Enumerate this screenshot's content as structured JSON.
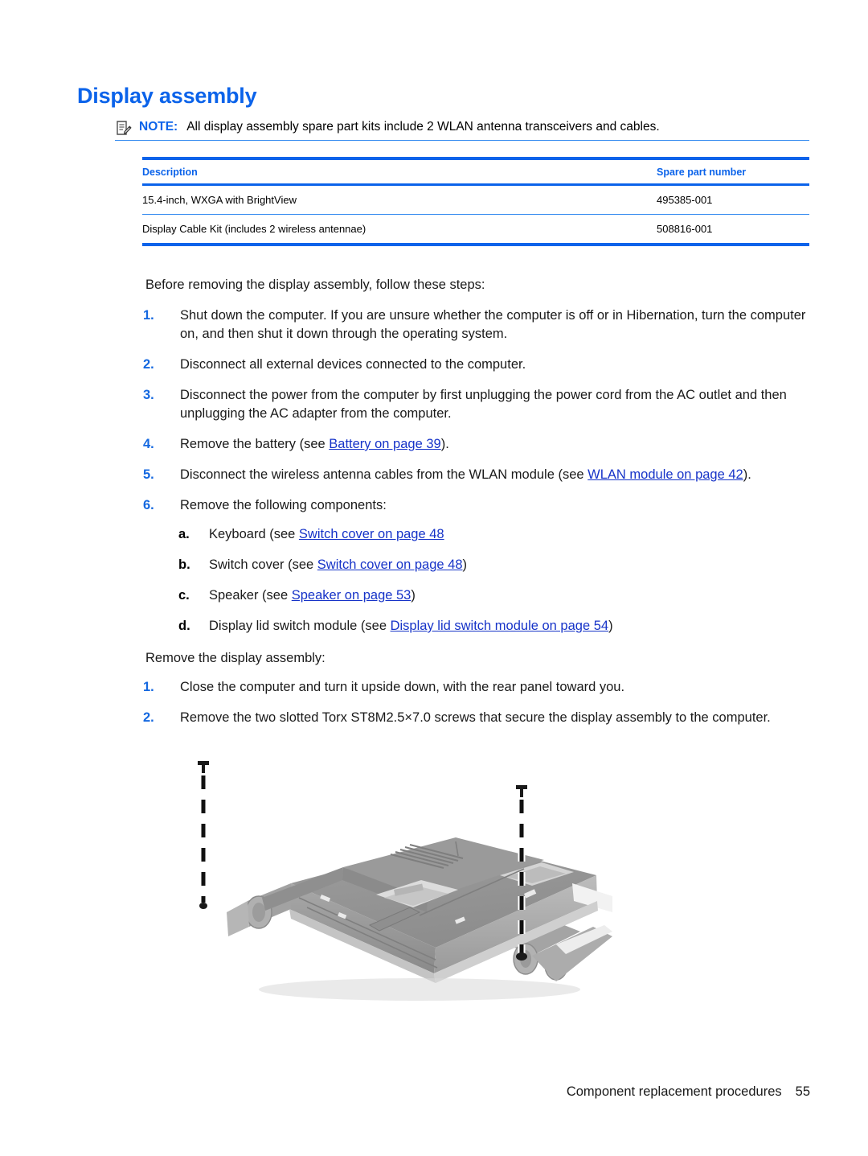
{
  "heading": "Display assembly",
  "note": {
    "icon": "note-pad-pencil-icon",
    "label": "NOTE:",
    "text": "All display assembly spare part kits include 2 WLAN antenna transceivers and cables."
  },
  "table": {
    "columns": [
      "Description",
      "Spare part number"
    ],
    "rows": [
      {
        "description": "15.4-inch, WXGA with BrightView",
        "part": "495385-001"
      },
      {
        "description": "Display Cable Kit (includes 2 wireless antennae)",
        "part": "508816-001"
      }
    ]
  },
  "intro_before": "Before removing the display assembly, follow these steps:",
  "steps_before": [
    {
      "marker": "1.",
      "text": "Shut down the computer. If you are unsure whether the computer is off or in Hibernation, turn the computer on, and then shut it down through the operating system."
    },
    {
      "marker": "2.",
      "text": "Disconnect all external devices connected to the computer."
    },
    {
      "marker": "3.",
      "text": "Disconnect the power from the computer by first unplugging the power cord from the AC outlet and then unplugging the AC adapter from the computer."
    },
    {
      "marker": "4.",
      "pre": "Remove the battery (see ",
      "link": "Battery on page 39",
      "post": ")."
    },
    {
      "marker": "5.",
      "pre": "Disconnect the wireless antenna cables from the WLAN module (see ",
      "link": "WLAN module on page 42",
      "post": ")."
    },
    {
      "marker": "6.",
      "text": "Remove the following components:"
    }
  ],
  "substeps": [
    {
      "marker": "a.",
      "pre": "Keyboard (see ",
      "link": "Switch cover on page 48",
      "post": ""
    },
    {
      "marker": "b.",
      "pre": "Switch cover (see ",
      "link": "Switch cover on page 48",
      "post": ")"
    },
    {
      "marker": "c.",
      "pre": "Speaker (see ",
      "link": "Speaker on page 53",
      "post": ")"
    },
    {
      "marker": "d.",
      "pre": "Display lid switch module (see ",
      "link": "Display lid switch module on page 54",
      "post": ")"
    }
  ],
  "intro_remove": "Remove the display assembly:",
  "steps_remove": [
    {
      "marker": "1.",
      "text": "Close the computer and turn it upside down, with the rear panel toward you."
    },
    {
      "marker": "2.",
      "text": "Remove the two slotted Torx ST8M2.5×7.0 screws that secure the display assembly to the computer."
    }
  ],
  "figure": {
    "caption_alt": "laptop-underside-with-two-screw-callouts",
    "screw_count": 2
  },
  "footer": {
    "label": "Component replacement procedures",
    "page": "55"
  },
  "colors": {
    "heading_blue": "#0b63ea",
    "rule_blue": "#0b63ea",
    "thin_rule_blue": "#3a8ef0",
    "link_blue": "#1633c8",
    "marker_blue": "#1468e0"
  }
}
